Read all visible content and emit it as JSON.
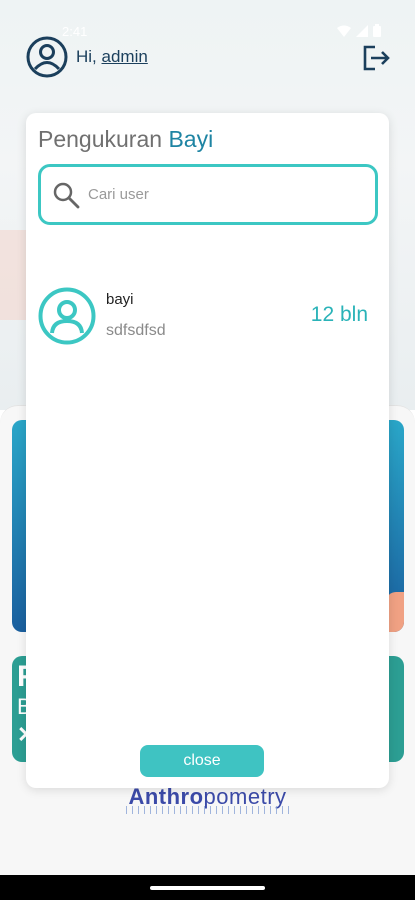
{
  "status_bar": {
    "time": "2:41"
  },
  "header": {
    "greeting_prefix": "Hi, ",
    "username": "admin"
  },
  "modal": {
    "title_prefix": "Pengukuran ",
    "title_accent": "Bayi",
    "search": {
      "placeholder": "Cari user",
      "value": ""
    },
    "users": [
      {
        "name": "bayi",
        "subtitle": "sdfsdfsd",
        "age": "12 bln"
      }
    ],
    "close_label": "close"
  },
  "footer": {
    "brand_bold": "Anthro",
    "brand_rest": "pometry"
  },
  "colors": {
    "accent_teal": "#3cc7c3",
    "title_blue": "#1e84a3",
    "age_teal": "#2ab3b8",
    "brand": "#3b4aa8"
  },
  "icons": [
    "user-circle-icon",
    "logout-icon",
    "search-icon",
    "wifi-icon",
    "signal-icon",
    "battery-icon"
  ]
}
